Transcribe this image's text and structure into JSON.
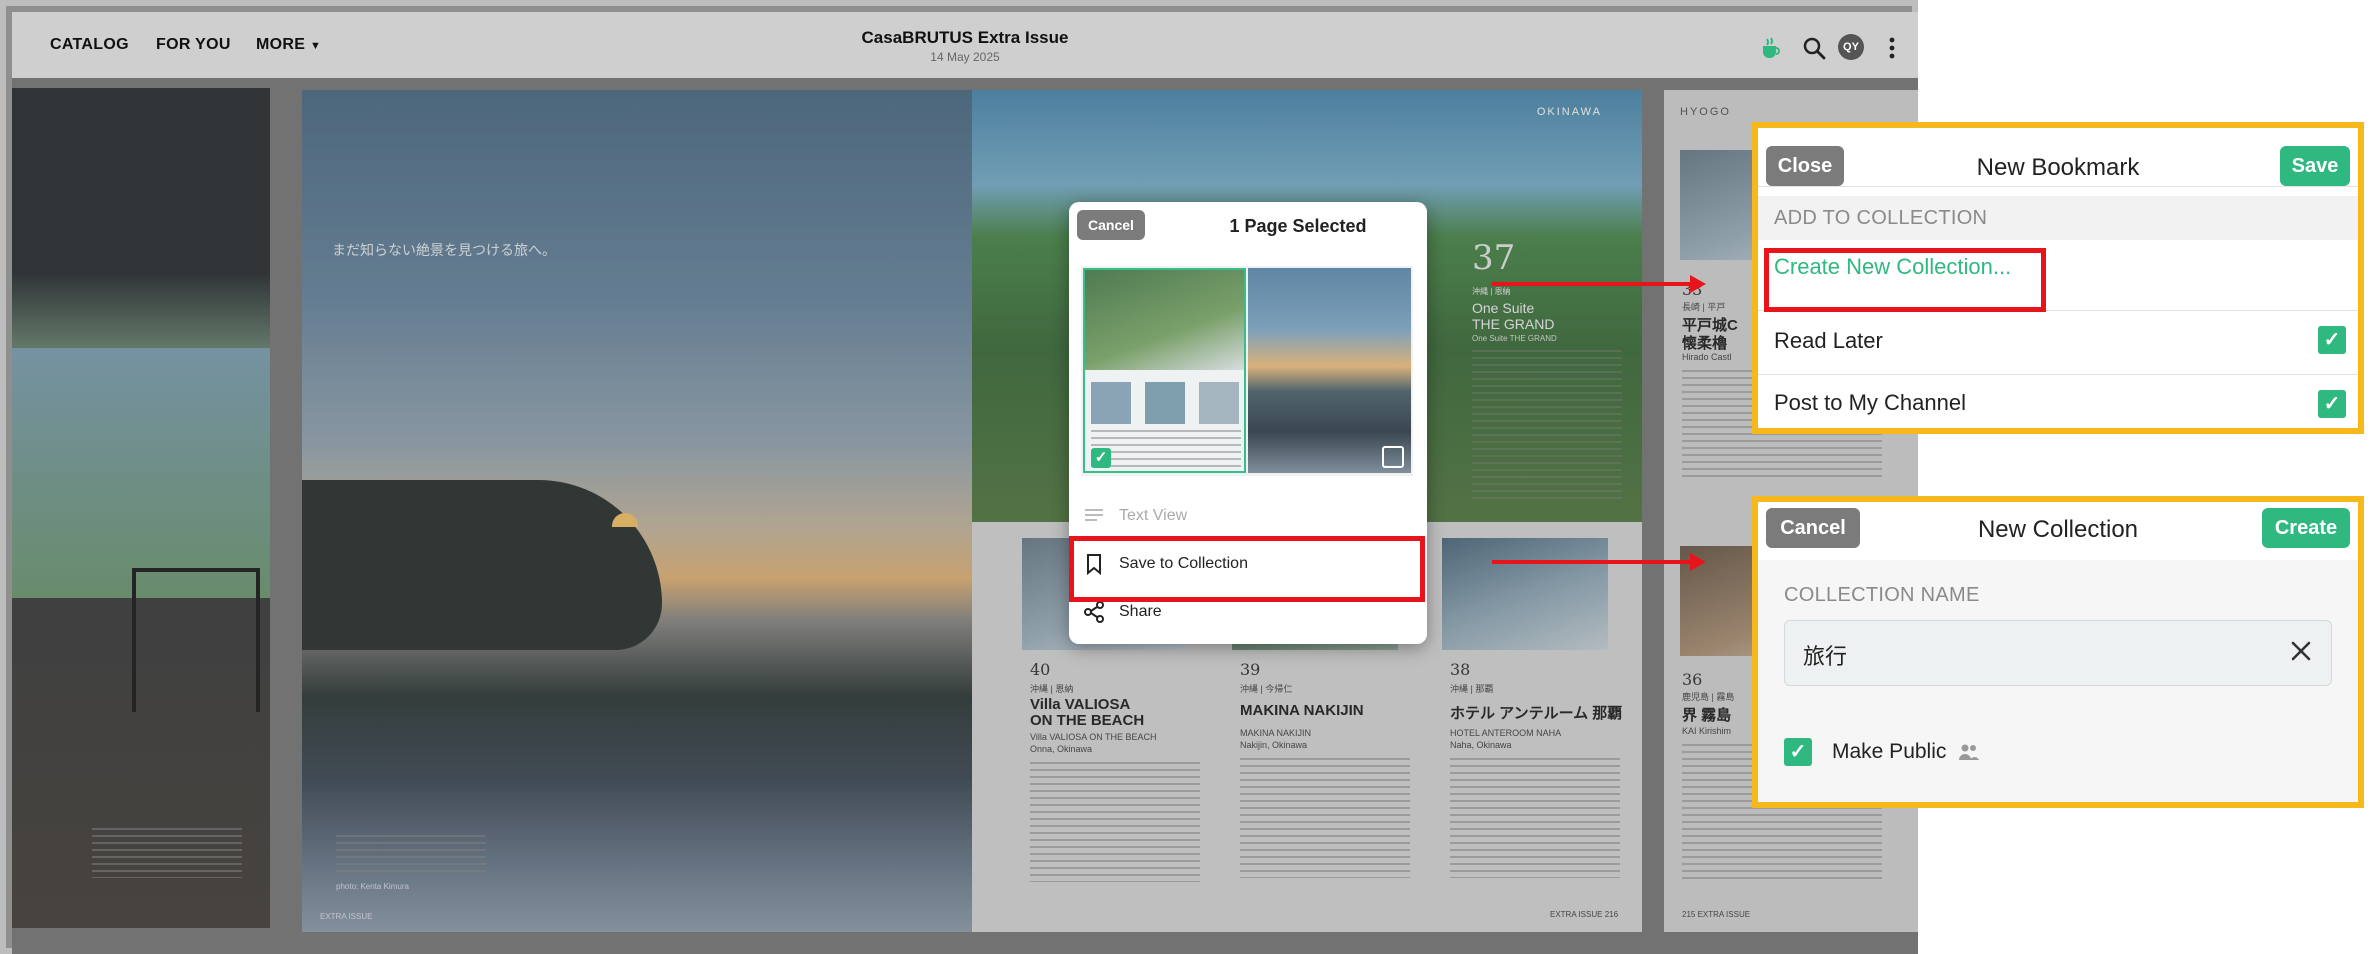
{
  "header": {
    "nav": [
      "CATALOG",
      "FOR YOU",
      "MORE"
    ],
    "title": "CasaBRUTUS Extra Issue",
    "date": "14 May 2025",
    "avatar_initials": "QY"
  },
  "pages": {
    "sunset_caption": "まだ知らない絶景を見つける旅へ。",
    "sunset_footer_credit": "photo: Kenta Kimura",
    "sunset_footer_page": "EXTRA ISSUE",
    "okinawa_label": "OKINAWA",
    "hero_number": "37",
    "hero_small": "沖縄 | 恩納",
    "hero_title_1": "One Suite",
    "hero_title_2": "THE GRAND",
    "hero_sub": "One Suite THE GRAND",
    "articles": [
      {
        "num": "40",
        "tag": "沖縄 | 恩納",
        "title_1": "Villa VALIOSA",
        "title_2": "ON THE BEACH",
        "sub": "Villa VALIOSA ON THE BEACH",
        "place": "Onna, Okinawa"
      },
      {
        "num": "39",
        "tag": "沖縄 | 今帰仁",
        "title_1": "MAKINA NAKIJIN",
        "title_2": "",
        "sub": "MAKINA NAKIJIN",
        "place": "Nakijin, Okinawa"
      },
      {
        "num": "38",
        "tag": "沖縄 | 那覇",
        "title_1": "ホテル アンテルーム 那覇",
        "title_2": "",
        "sub": "HOTEL ANTEROOM NAHA",
        "place": "Naha, Okinawa"
      }
    ],
    "okinawa_footer": "EXTRA ISSUE",
    "okinawa_footer_num": "216",
    "right_label": "HYOGO",
    "right_num_1": "33",
    "right_tag_1": "長崎 | 平戸",
    "right_title_1a": "平戸城C",
    "right_title_1b": "懐柔櫓",
    "right_sub_1": "Hirado Castl",
    "right_num_2": "36",
    "right_tag_2": "鹿児島 | 霧島",
    "right_title_2": "界 霧島",
    "right_sub_2": "KAI Kirishim",
    "right_footer": "215",
    "right_footer_label": "EXTRA ISSUE"
  },
  "popover": {
    "cancel": "Cancel",
    "title": "1 Page Selected",
    "menu": [
      {
        "label": "Text View",
        "enabled": false
      },
      {
        "label": "Save to Collection",
        "enabled": true
      },
      {
        "label": "Share",
        "enabled": true
      }
    ]
  },
  "bookmark_panel": {
    "close": "Close",
    "title": "New Bookmark",
    "save": "Save",
    "section": "ADD TO COLLECTION",
    "create_link": "Create New Collection...",
    "rows": [
      {
        "label": "Read Later",
        "checked": true
      },
      {
        "label": "Post to My Channel",
        "checked": true
      }
    ]
  },
  "collection_panel": {
    "cancel": "Cancel",
    "title": "New Collection",
    "create": "Create",
    "field_label": "COLLECTION NAME",
    "field_value": "旅行",
    "make_public": "Make Public",
    "make_public_checked": true
  },
  "colors": {
    "accent_green": "#2fb980",
    "highlight_red": "#e8141c",
    "highlight_yellow": "#f6b81a",
    "button_gray": "#7b7b7b"
  }
}
